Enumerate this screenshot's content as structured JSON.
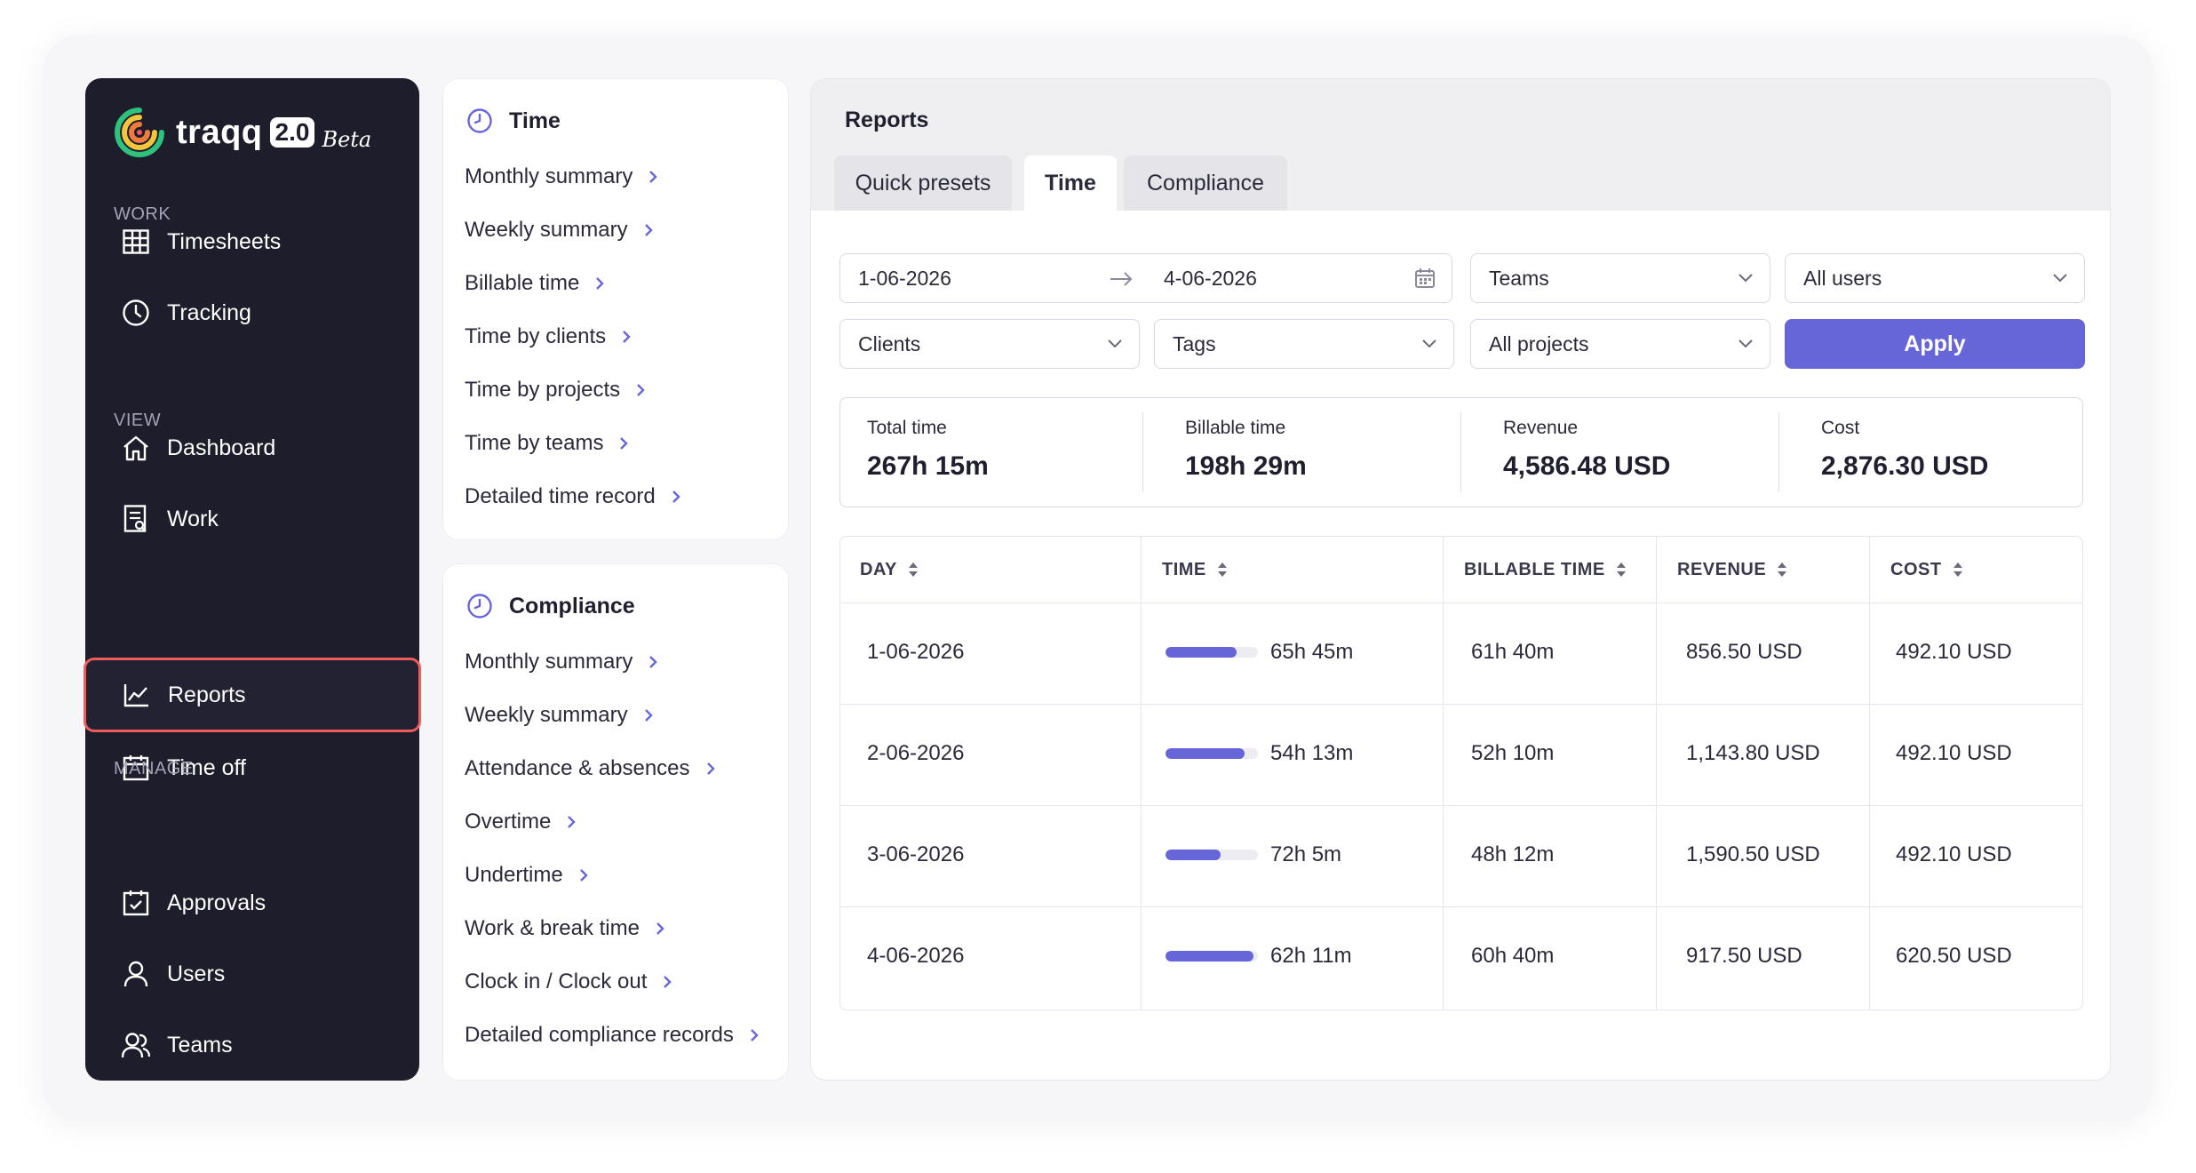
{
  "app": {
    "logo_text": "traqq",
    "logo_badge": "2.0",
    "logo_beta": "Beta"
  },
  "sidebar": {
    "sections": [
      {
        "label": "WORK"
      },
      {
        "label": "VIEW"
      },
      {
        "label": "MANAGE"
      }
    ],
    "items": [
      {
        "label": "Timesheets",
        "icon": "grid-icon"
      },
      {
        "label": "Tracking",
        "icon": "clock-icon"
      },
      {
        "label": "Dashboard",
        "icon": "home-icon"
      },
      {
        "label": "Work",
        "icon": "document-icon"
      },
      {
        "label": "Reports",
        "icon": "chart-icon",
        "active": true
      },
      {
        "label": "Time off",
        "icon": "calendar-icon"
      },
      {
        "label": "Approvals",
        "icon": "calendar-check-icon"
      },
      {
        "label": "Users",
        "icon": "user-icon"
      },
      {
        "label": "Teams",
        "icon": "team-icon"
      }
    ]
  },
  "time_panel": {
    "title": "Time",
    "links": [
      "Monthly summary",
      "Weekly summary",
      "Billable time",
      "Time by clients",
      "Time by projects",
      "Time by teams",
      "Detailed time record"
    ]
  },
  "compliance_panel": {
    "title": "Compliance",
    "links": [
      "Monthly summary",
      "Weekly summary",
      "Attendance & absences",
      "Overtime",
      "Undertime",
      "Work & break time",
      "Clock in / Clock out",
      "Detailed compliance records"
    ]
  },
  "main": {
    "title": "Reports",
    "tabs": [
      {
        "label": "Quick presets"
      },
      {
        "label": "Time",
        "active": true
      },
      {
        "label": "Compliance"
      }
    ],
    "filters": {
      "date_from": "1-06-2026",
      "date_to": "4-06-2026",
      "teams": "Teams",
      "users": "All users",
      "clients": "Clients",
      "tags": "Tags",
      "projects": "All projects",
      "apply_label": "Apply"
    },
    "stats": [
      {
        "label": "Total time",
        "value": "267h 15m"
      },
      {
        "label": "Billable time",
        "value": "198h 29m"
      },
      {
        "label": "Revenue",
        "value": "4,586.48 USD"
      },
      {
        "label": "Cost",
        "value": "2,876.30 USD"
      }
    ],
    "table": {
      "columns": [
        "DAY",
        "TIME",
        "BILLABLE TIME",
        "REVENUE",
        "COST"
      ],
      "rows": [
        {
          "day": "1-06-2026",
          "time": "65h 45m",
          "time_fraction": 0.77,
          "billable": "61h 40m",
          "revenue": "856.50 USD",
          "cost": "492.10 USD"
        },
        {
          "day": "2-06-2026",
          "time": "54h 13m",
          "time_fraction": 0.86,
          "billable": "52h 10m",
          "revenue": "1,143.80 USD",
          "cost": "492.10 USD"
        },
        {
          "day": "3-06-2026",
          "time": "72h 5m",
          "time_fraction": 0.6,
          "billable": "48h 12m",
          "revenue": "1,590.50 USD",
          "cost": "492.10 USD"
        },
        {
          "day": "4-06-2026",
          "time": "62h 11m",
          "time_fraction": 0.95,
          "billable": "60h 40m",
          "revenue": "917.50 USD",
          "cost": "620.50 USD"
        }
      ]
    }
  },
  "colors": {
    "accent": "#6766d9",
    "sidebar_bg": "#1e1d2b",
    "active_outline": "#f15b5b"
  }
}
